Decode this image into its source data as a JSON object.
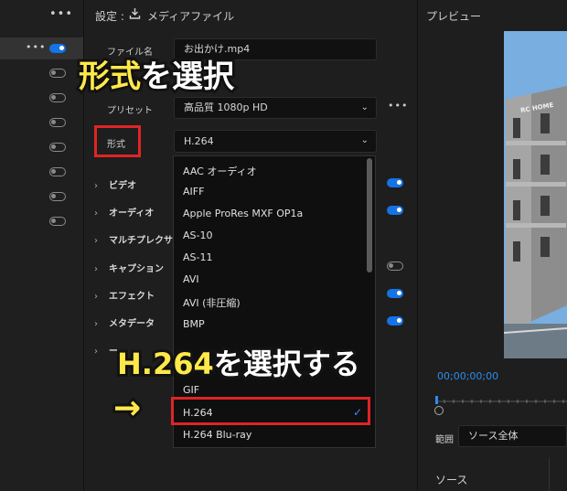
{
  "left_rail": {
    "menu": "•••",
    "row_menu": "•••"
  },
  "settings": {
    "title": "設定 :",
    "source_label": "メディアファイル",
    "filename_label": "ファイル名",
    "filename_value": "お出かけ.mp4",
    "preset_label": "プリセット",
    "preset_value": "高品質 1080p HD",
    "more": "•••",
    "format_label": "形式",
    "format_value": "H.264",
    "sections": [
      "ビデオ",
      "オーディオ",
      "マルチプレクサー",
      "キャプション",
      "エフェクト",
      "メタデータ",
      "ー"
    ]
  },
  "format_options": [
    "AAC オーディオ",
    "AIFF",
    "Apple ProRes MXF OP1a",
    "AS-10",
    "AS-11",
    "AVI",
    "AVI (非圧縮)",
    "BMP",
    "GIF",
    "H.264",
    "H.264 Blu-ray"
  ],
  "selected_format": "H.264",
  "check_mark": "✓",
  "preview": {
    "title": "プレビュー",
    "timecode": "00;00;00;00",
    "range_label": "範囲",
    "range_value": "ソース全体",
    "source_label": "ソース",
    "building_sign": "RC HOME"
  },
  "annotations": {
    "callout1_hl": "形式",
    "callout1_rest": "を選択",
    "callout2_hl": "H.264",
    "callout2_rest": "を選択する",
    "arrow": "→"
  },
  "colors": {
    "accent_blue": "#1473e6",
    "annotation_red": "#e02424",
    "annotation_yellow": "#ffe94a"
  }
}
